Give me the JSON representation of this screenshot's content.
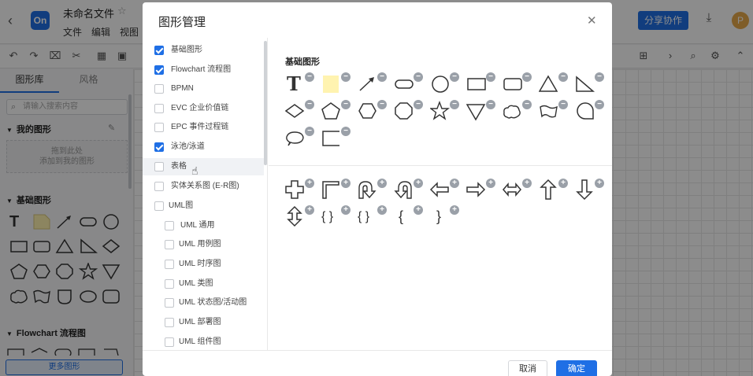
{
  "app": {
    "logo_text": "On",
    "doc_title": "未命名文件",
    "menus": [
      "文件",
      "编辑",
      "视图"
    ],
    "share_label": "分享协作",
    "avatar_letter": "P"
  },
  "sidebar": {
    "tabs": [
      "图形库",
      "风格"
    ],
    "search_placeholder": "请输入搜索内容",
    "my_shapes_title": "我的图形",
    "dropzone_line1": "拖到此处",
    "dropzone_line2": "添加到我的图形",
    "basic_title": "基础图形",
    "flowchart_title": "Flowchart 流程图",
    "more_label": "更多图形",
    "shape_text_glyph": "T"
  },
  "dialog": {
    "title": "图形管理",
    "categories": [
      {
        "label": "基础图形",
        "checked": true
      },
      {
        "label": "Flowchart 流程图",
        "checked": true
      },
      {
        "label": "BPMN",
        "checked": false
      },
      {
        "label": "EVC 企业价值链",
        "checked": false
      },
      {
        "label": "EPC 事件过程链",
        "checked": false
      },
      {
        "label": "泳池/泳道",
        "checked": true
      },
      {
        "label": "表格",
        "checked": false
      },
      {
        "label": "实体关系图 (E-R图)",
        "checked": false
      },
      {
        "label": "UML图",
        "checked": false
      },
      {
        "label": "UML 通用",
        "checked": false
      },
      {
        "label": "UML 用例图",
        "checked": false
      },
      {
        "label": "UML 时序图",
        "checked": false
      },
      {
        "label": "UML 类图",
        "checked": false
      },
      {
        "label": "UML 状态图/活动图",
        "checked": false
      },
      {
        "label": "UML 部署图",
        "checked": false
      },
      {
        "label": "UML 组件图",
        "checked": false
      }
    ],
    "group_title": "基础图形",
    "shape_text_glyph": "T",
    "remove_glyph": "−",
    "add_glyph": "+",
    "brace_glyphs": [
      "{  }",
      "{ }",
      "{",
      "}"
    ],
    "cancel_label": "取消",
    "ok_label": "确定"
  },
  "colors": {
    "accent": "#1f6fe5",
    "badge_gray": "#9aa0a8",
    "note_yellow": "#fff3b0"
  }
}
